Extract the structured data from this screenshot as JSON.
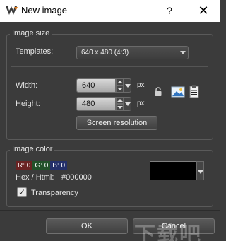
{
  "window": {
    "title": "New image",
    "help_glyph": "?",
    "close_glyph": "✕"
  },
  "image_size": {
    "group_title": "Image size",
    "templates_label": "Templates:",
    "template_value": "640 x 480  (4:3)",
    "width_label": "Width:",
    "width_value": "640",
    "height_label": "Height:",
    "height_value": "480",
    "unit": "px",
    "screen_resolution_button": "Screen resolution"
  },
  "image_color": {
    "group_title": "Image color",
    "r_label": "R:",
    "r_value": "0",
    "g_label": "G:",
    "g_value": "0",
    "b_label": "B:",
    "b_value": "0",
    "hex_label": "Hex / Html:",
    "hex_value": "#000000",
    "swatch_color": "#000000",
    "transparency_label": "Transparency",
    "transparency_checked": true
  },
  "buttons": {
    "ok": "OK",
    "cancel": "Cancel"
  },
  "watermark_text": "下载吧"
}
